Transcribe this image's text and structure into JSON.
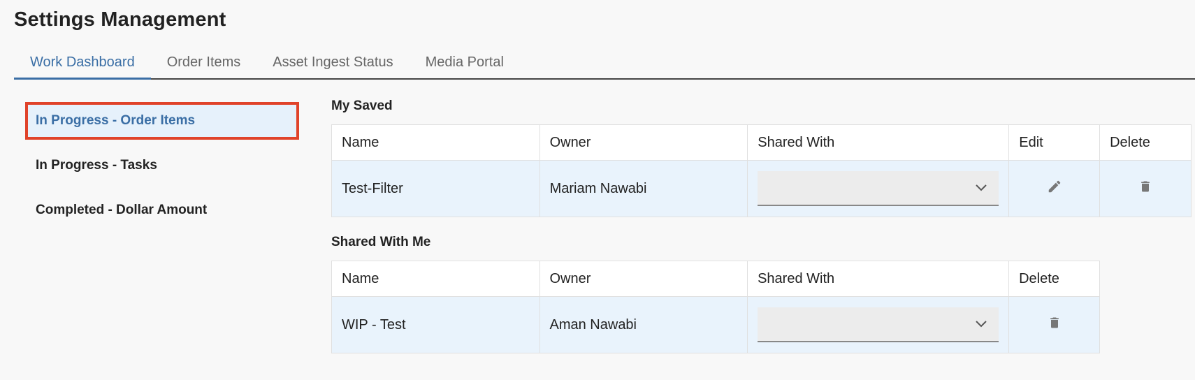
{
  "page": {
    "title": "Settings Management"
  },
  "tabs": [
    {
      "label": "Work Dashboard",
      "active": true
    },
    {
      "label": "Order Items"
    },
    {
      "label": "Asset Ingest Status"
    },
    {
      "label": "Media Portal"
    }
  ],
  "sidebar": {
    "items": [
      {
        "label": "In Progress - Order Items",
        "active": true
      },
      {
        "label": "In Progress - Tasks"
      },
      {
        "label": "Completed - Dollar Amount"
      }
    ]
  },
  "my_saved": {
    "title": "My Saved",
    "headers": {
      "name": "Name",
      "owner": "Owner",
      "shared_with": "Shared With",
      "edit": "Edit",
      "delete": "Delete"
    },
    "rows": [
      {
        "name": "Test-Filter",
        "owner": "Mariam Nawabi",
        "shared_with": ""
      }
    ]
  },
  "shared_with_me": {
    "title": "Shared With Me",
    "headers": {
      "name": "Name",
      "owner": "Owner",
      "shared_with": "Shared With",
      "delete": "Delete"
    },
    "rows": [
      {
        "name": "WIP - Test",
        "owner": "Aman Nawabi",
        "shared_with": ""
      }
    ]
  },
  "icons": {
    "chevron": "chevron-down-icon",
    "edit": "pencil-icon",
    "delete": "trash-icon"
  },
  "colors": {
    "accent": "#3a6ea5",
    "highlight_border": "#e0432a",
    "row_background": "#e9f3fc"
  }
}
